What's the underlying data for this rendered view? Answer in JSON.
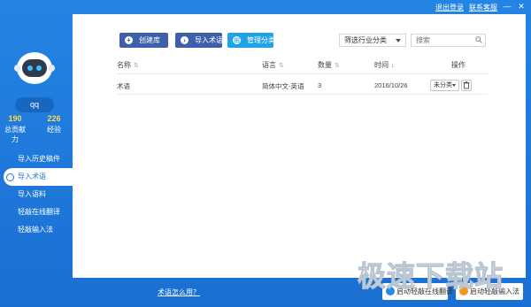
{
  "titlebar": {
    "logout": "退出登录",
    "contact": "联系客服",
    "minimize": "—",
    "close": "✕"
  },
  "user": {
    "name": "qq",
    "stats": [
      {
        "value": "190",
        "label": "总贡献力"
      },
      {
        "value": "226",
        "label": "经验"
      }
    ]
  },
  "nav": [
    {
      "label": "导入历史稿件",
      "active": false
    },
    {
      "label": "导入术语",
      "active": true
    },
    {
      "label": "导入语料",
      "active": false
    },
    {
      "label": "轻敲在线翻译",
      "active": false
    },
    {
      "label": "轻敲输入法",
      "active": false
    }
  ],
  "toolbar": {
    "create": "创建库",
    "import_terms": "导入术语",
    "manage_category": "管理分类",
    "industry_select": "筛选行业分类",
    "search_placeholder": "搜索"
  },
  "table": {
    "headers": {
      "name": "名称",
      "language": "语言",
      "count": "数量",
      "time": "时间",
      "action": "操作"
    },
    "rows": [
      {
        "name": "术语",
        "language": "简体中文-英语",
        "count": "3",
        "time": "2016/10/26",
        "category": "未分类"
      }
    ]
  },
  "footer": {
    "help": "术语怎么用？",
    "online_translate": "启动轻敲在线翻译",
    "input_method": "启动轻敲输入法"
  },
  "watermark": "极速下载站",
  "colors": {
    "brand_blue": "#1e78d8",
    "button_dark": "#3f5eab",
    "button_light": "#1ea3e8",
    "stat_yellow": "#ffd84a",
    "ime_orange": "#f39a1e"
  }
}
